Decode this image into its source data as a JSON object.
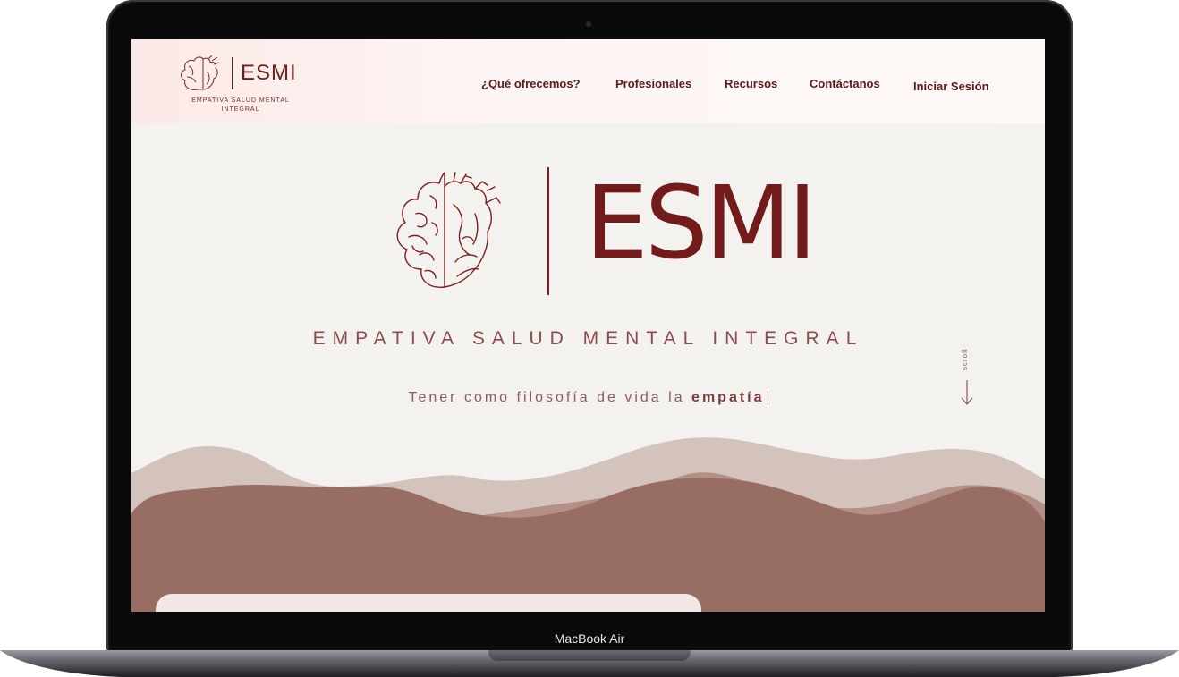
{
  "device": {
    "label": "MacBook Air"
  },
  "header": {
    "logo_word": "ESMI",
    "logo_tagline": "EMPATIVA SALUD MENTAL INTEGRAL",
    "nav": [
      {
        "label": "¿Qué ofrecemos?"
      },
      {
        "label": "Profesionales"
      },
      {
        "label": "Recursos"
      },
      {
        "label": "Contáctanos"
      },
      {
        "label": "Iniciar Sesión"
      }
    ]
  },
  "hero": {
    "brand": "ESMI",
    "subtitle": "EMPATIVA SALUD MENTAL INTEGRAL",
    "phrase_prefix": "Tener como filosofía de vida la ",
    "phrase_bold": "empatía",
    "scroll_label": "scroll"
  },
  "colors": {
    "brand": "#731b1b",
    "background": "#f3f2ef",
    "wave_light": "#d4c3bd",
    "wave_mid": "#b38f87",
    "wave_dark": "#986d63"
  },
  "icons": [
    "brain-heart-icon",
    "arrow-down-icon"
  ]
}
